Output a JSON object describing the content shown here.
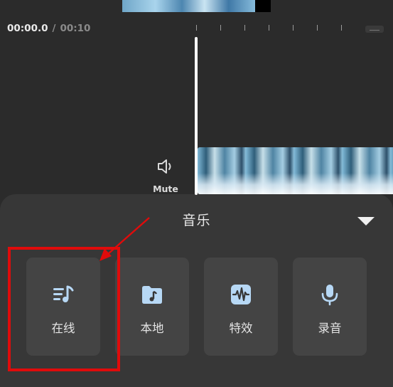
{
  "timeline": {
    "current_time": "00:00.0",
    "separator": "/",
    "total_time": "00:10"
  },
  "audio": {
    "mute_label": "Mute"
  },
  "sheet": {
    "title": "音乐",
    "options": [
      {
        "label": "在线",
        "icon": "online-music-icon"
      },
      {
        "label": "本地",
        "icon": "local-music-folder-icon"
      },
      {
        "label": "特效",
        "icon": "sound-effect-icon"
      },
      {
        "label": "录音",
        "icon": "microphone-icon"
      }
    ]
  },
  "colors": {
    "background": "#2b2b2b",
    "sheet": "#373737",
    "tile": "#444444",
    "icon_accent": "#b7d8f5",
    "annotation_red": "#e00b0b"
  }
}
